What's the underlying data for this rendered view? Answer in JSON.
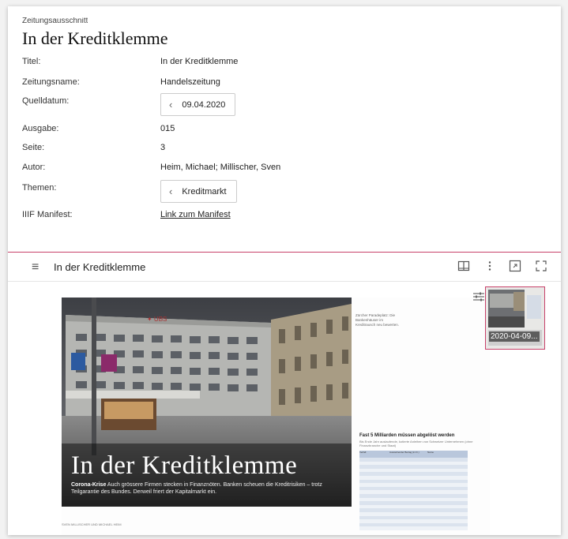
{
  "kicker": "Zeitungsausschnitt",
  "title": "In der Kreditklemme",
  "fields": [
    {
      "label": "Titel:",
      "value": "In der Kreditklemme"
    },
    {
      "label": "Zeitungsname:",
      "value": "Handelszeitung"
    },
    {
      "label": "Quelldatum:",
      "value": "09.04.2020"
    },
    {
      "label": "Ausgabe:",
      "value": "015"
    },
    {
      "label": "Seite:",
      "value": "3"
    },
    {
      "label": "Autor:",
      "value": "Heim, Michael; Millischer, Sven"
    },
    {
      "label": "Themen:",
      "value": "Kreditmarkt"
    },
    {
      "label": "IIIF Manifest:",
      "value": "Link zum Manifest"
    }
  ],
  "viewer": {
    "title": "In der Kreditklemme",
    "thumbnail_label": "2020-04-09...",
    "accent": "#c8416a"
  },
  "article": {
    "headline": "In der Kreditklemme",
    "lede_bold": "Corona-Krise",
    "lede": "Auch grössere Firmen stecken in Finanznöten. Banken scheuen die Kreditrisiken – trotz Teilgarantie des Bundes. Derweil friert der Kapitalmarkt ein.",
    "photo_caption": "Zürcher Paradeplatz: Die Bankenhäuser im Kreditrausch neu bewerten.",
    "table_title": "Fast 5 Milliarden müssen abgelöst werden",
    "table_sub": "Bis Ende Jahr auslaufende, kotierte Anleihen von Schweizer Unternehmen (ohne Finanzbranche und Staat)",
    "table_headers": [
      "Verfall",
      "Ausstehender Betrag (in Fr.)",
      "Name"
    ],
    "byline": "SVEN MILLISCHER UND MICHAEL HEIM"
  }
}
